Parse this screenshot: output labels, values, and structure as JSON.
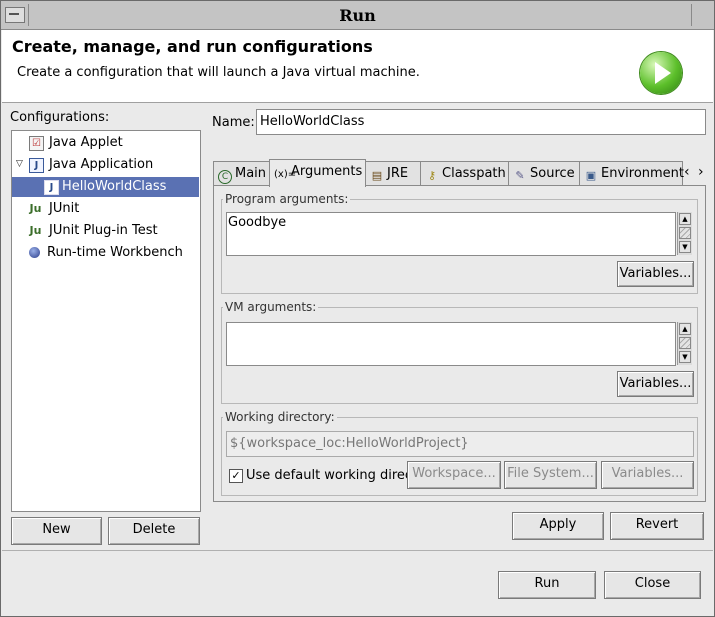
{
  "window": {
    "title": "Run"
  },
  "header": {
    "title": "Create, manage, and run configurations",
    "subtitle": "Create a configuration that will launch a Java virtual machine."
  },
  "configurations": {
    "label": "Configurations:",
    "items": [
      {
        "label": "Java Applet",
        "icon": "java-applet-icon"
      },
      {
        "label": "Java Application",
        "icon": "java-application-icon",
        "expanded": true
      },
      {
        "label": "HelloWorldClass",
        "icon": "java-class-icon",
        "selected": true
      },
      {
        "label": "JUnit",
        "icon": "junit-icon"
      },
      {
        "label": "JUnit Plug-in Test",
        "icon": "junit-plugin-icon"
      },
      {
        "label": "Run-time Workbench",
        "icon": "workbench-icon"
      }
    ],
    "new_label": "New",
    "delete_label": "Delete"
  },
  "name": {
    "label": "Name:",
    "value": "HelloWorldClass"
  },
  "tabs": [
    {
      "label": "Main",
      "icon": "main-tab-icon"
    },
    {
      "label": "Arguments",
      "icon": "arguments-tab-icon",
      "active": true
    },
    {
      "label": "JRE",
      "icon": "jre-tab-icon"
    },
    {
      "label": "Classpath",
      "icon": "classpath-tab-icon"
    },
    {
      "label": "Source",
      "icon": "source-tab-icon"
    },
    {
      "label": "Environment",
      "icon": "environment-tab-icon"
    }
  ],
  "tab_scroll": "‹ ›",
  "arguments": {
    "program_label": "Program arguments:",
    "program_value": "Goodbye",
    "program_variables": "Variables...",
    "vm_label": "VM arguments:",
    "vm_value": "",
    "vm_variables": "Variables...",
    "workdir_label": "Working directory:",
    "workdir_value": "${workspace_loc:HelloWorldProject}",
    "use_default_label": "Use default working director",
    "use_default_checked": true,
    "workspace_btn": "Workspace...",
    "filesystem_btn": "File System...",
    "variables_btn": "Variables..."
  },
  "actions": {
    "apply": "Apply",
    "revert": "Revert",
    "run": "Run",
    "close": "Close"
  },
  "colors": {
    "selection": "#5a71b3",
    "run_icon": "#5cbf2a"
  }
}
